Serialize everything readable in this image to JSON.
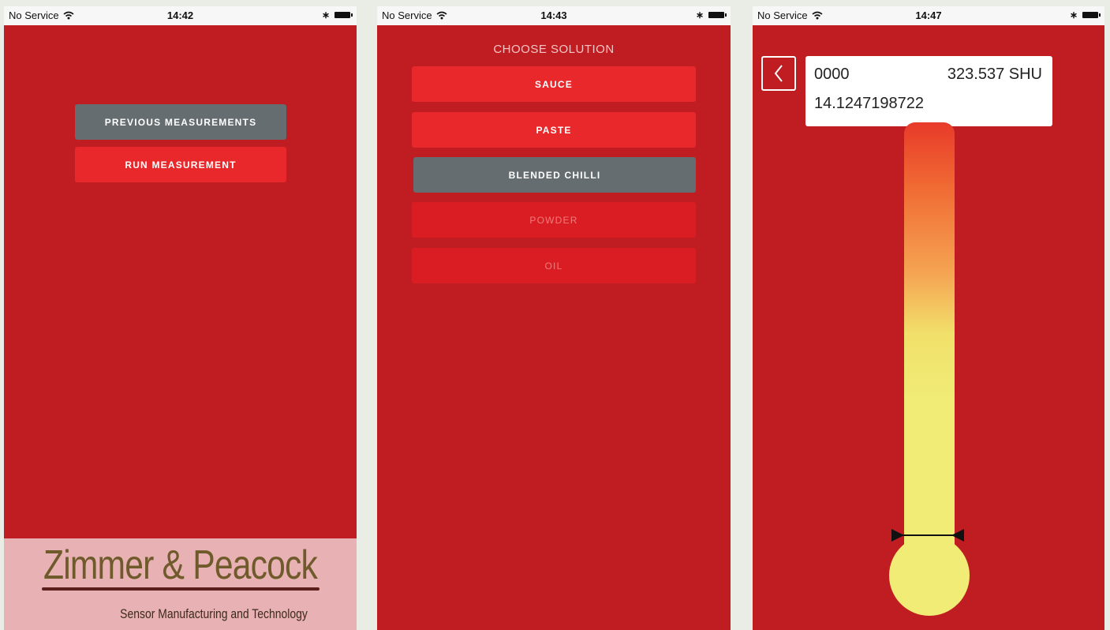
{
  "status_bars": [
    {
      "carrier": "No Service",
      "time": "14:42"
    },
    {
      "carrier": "No Service",
      "time": "14:43"
    },
    {
      "carrier": "No Service",
      "time": "14:47"
    }
  ],
  "home": {
    "previous_label": "PREVIOUS MEASUREMENTS",
    "run_label": "RUN MEASUREMENT",
    "brand_name": "Zimmer & Peacock",
    "brand_tagline": "Sensor Manufacturing and Technology"
  },
  "solution": {
    "heading": "CHOOSE SOLUTION",
    "options": [
      "SAUCE",
      "PASTE",
      "BLENDED CHILLI",
      "POWDER",
      "OIL"
    ],
    "selected": "BLENDED CHILLI"
  },
  "measurement": {
    "sample_code": "0000",
    "shu_value": "323.537 SHU",
    "raw_value": "14.1247198722"
  },
  "colors": {
    "background": "#c01d22",
    "button_red": "#e8282a",
    "button_selected": "#666d70",
    "thermometer_hot": "#e83a2a",
    "thermometer_cool": "#f0ec76"
  },
  "icons": [
    "wifi-icon",
    "bluetooth-icon",
    "battery-icon",
    "back-chevron-icon"
  ]
}
